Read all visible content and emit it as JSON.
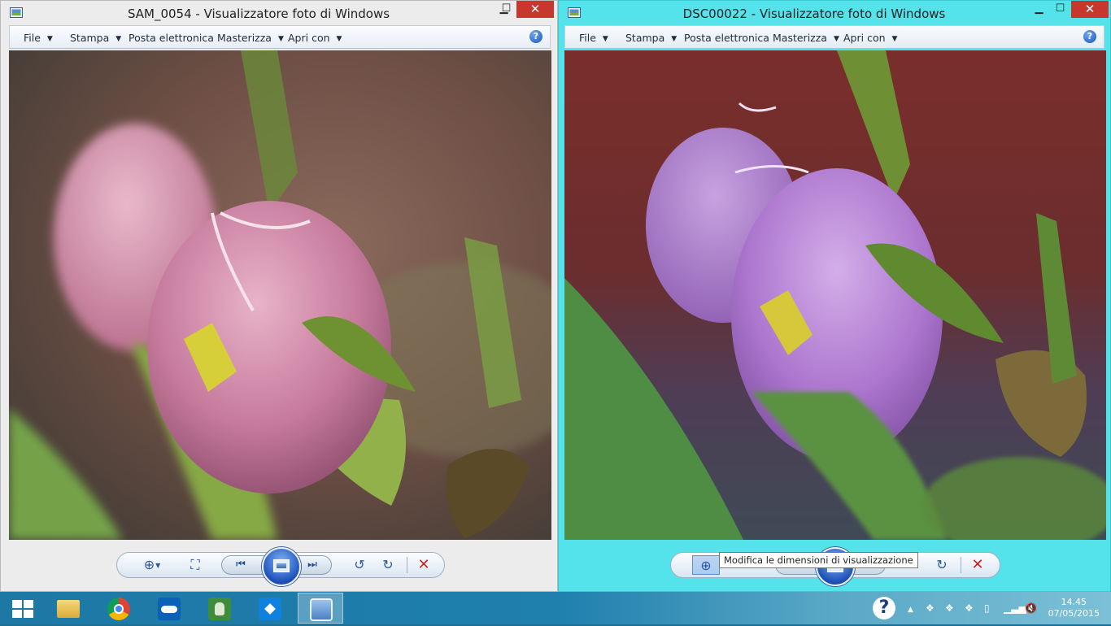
{
  "left_window": {
    "title": "SAM_0054 - Visualizzatore foto di Windows",
    "minimize_glyph": "▁",
    "maximize_glyph": "☐",
    "close_glyph": "✕",
    "menu": [
      {
        "label": "File",
        "has_dropdown": true
      },
      {
        "label": "Stampa",
        "has_dropdown": true
      },
      {
        "label": "Posta elettronica",
        "has_dropdown": false
      },
      {
        "label": "Masterizza",
        "has_dropdown": true
      },
      {
        "label": "Apri con",
        "has_dropdown": true
      }
    ],
    "help_glyph": "?",
    "photo": {
      "subject": "pink flower bud macro",
      "dominant_colors": [
        "#d58fb0",
        "#8fb24a",
        "#7a4a3a"
      ]
    }
  },
  "right_window": {
    "title": "DSC00022 - Visualizzatore foto di Windows",
    "minimize_glyph": "▁",
    "maximize_glyph": "☐",
    "close_glyph": "✕",
    "menu": [
      {
        "label": "File",
        "has_dropdown": true
      },
      {
        "label": "Stampa",
        "has_dropdown": true
      },
      {
        "label": "Posta elettronica",
        "has_dropdown": false
      },
      {
        "label": "Masterizza",
        "has_dropdown": true
      },
      {
        "label": "Apri con",
        "has_dropdown": true
      }
    ],
    "help_glyph": "?",
    "photo": {
      "subject": "purple flower bud macro",
      "dominant_colors": [
        "#b07ed0",
        "#5f9a45",
        "#7a2f2d"
      ]
    },
    "tooltip": "Modifica le dimensioni di visualizzazione"
  },
  "controls_glyphs": {
    "zoom": "⊕",
    "fit": "⛶",
    "prev": "⏮",
    "next": "⏭",
    "rotate_ccw": "↺",
    "rotate_cw": "↻",
    "delete": "✕"
  },
  "taskbar": {
    "apps": [
      "file-explorer",
      "chrome",
      "onedrive",
      "evernote",
      "dropbox",
      "photo-viewer"
    ],
    "active_app": "photo-viewer",
    "help_glyph": "?",
    "tray_arrow": "▲",
    "time": "14.45",
    "date": "07/05/2015"
  },
  "colors": {
    "left_frame": "#ececec",
    "right_frame": "#55e3eb",
    "close_button": "#c7372d",
    "taskbar": "#1f7fad"
  }
}
